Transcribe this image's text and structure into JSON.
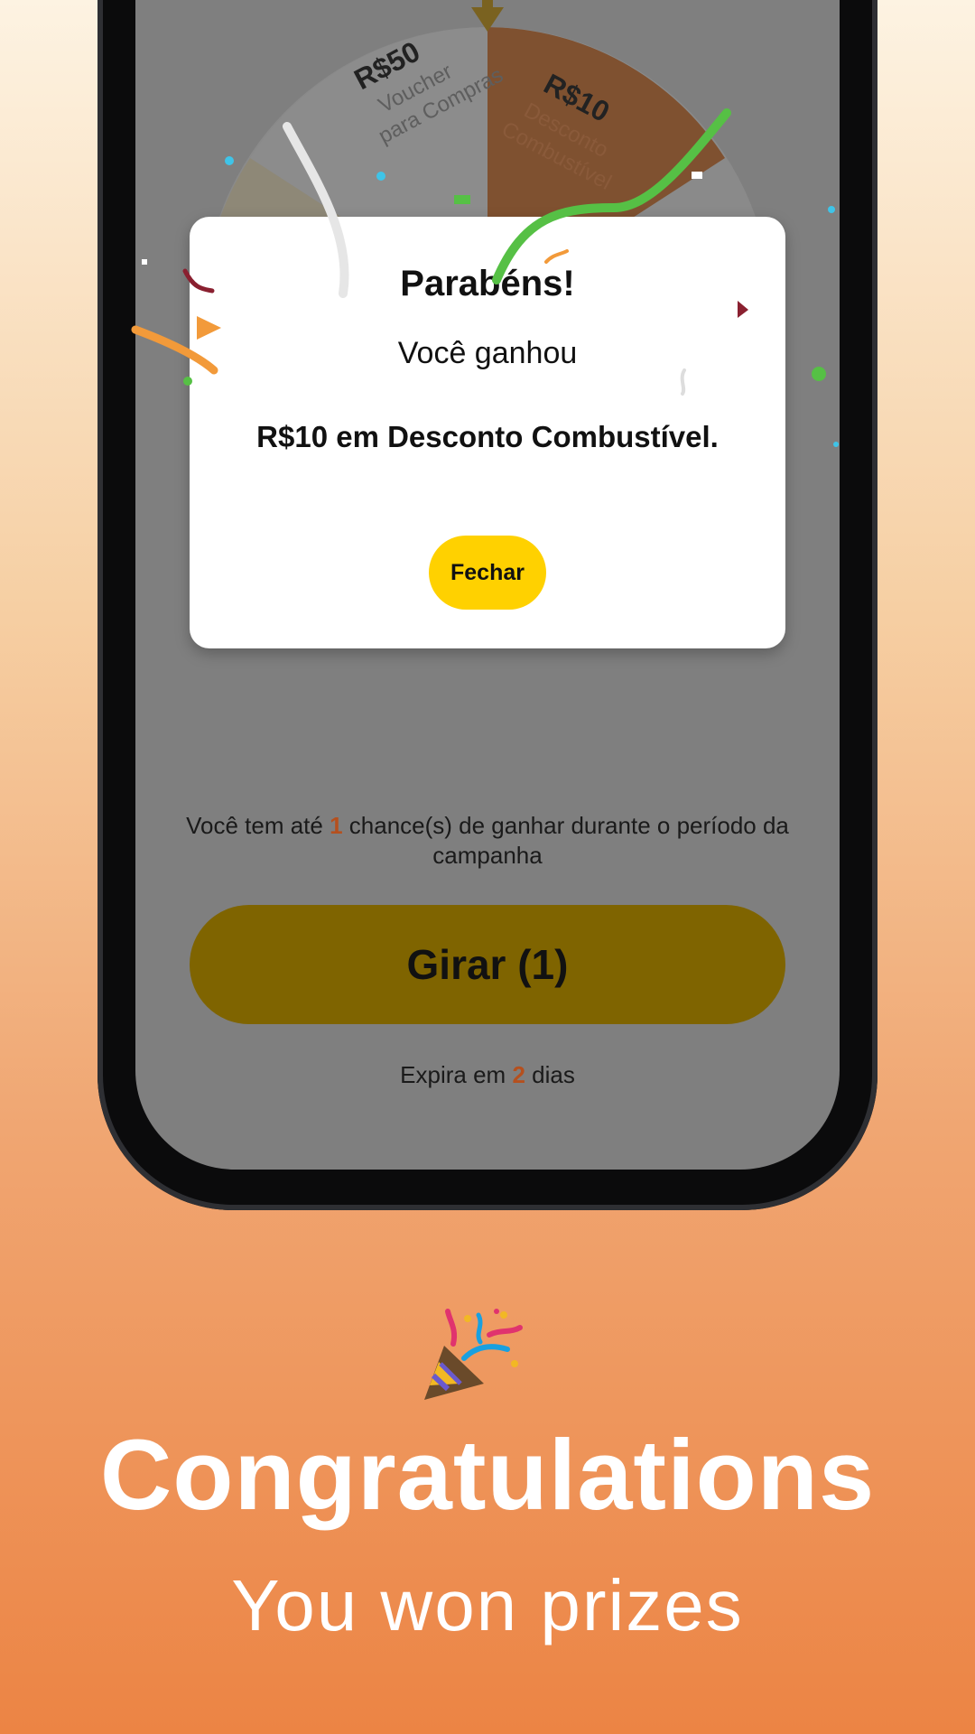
{
  "colors": {
    "accent": "#ffd100",
    "spin_button_dimmed": "#7f6400",
    "highlight_number": "#b5501e",
    "overlay_gray": "#7f7f7f"
  },
  "wheel": {
    "segments": [
      {
        "amount": "R$50",
        "line1": "Voucher",
        "line2": "para Compras"
      },
      {
        "amount": "R$10",
        "line1": "Desconto",
        "line2": "Combustível"
      }
    ]
  },
  "modal": {
    "title": "Parabéns!",
    "subtitle": "Você ganhou",
    "prize": "R$10 em Desconto Combustível.",
    "close_label": "Fechar"
  },
  "info": {
    "chance_prefix": "Você tem até ",
    "chance_count": "1",
    "chance_suffix": " chance(s) de ganhar durante o período da campanha"
  },
  "spin_button": {
    "label": "Girar (1)"
  },
  "expiry": {
    "prefix": "Expira em ",
    "days": "2",
    "suffix": " dias"
  },
  "promo": {
    "icon": "party-popper-icon",
    "headline": "Congratulations",
    "subline": "You won prizes"
  }
}
